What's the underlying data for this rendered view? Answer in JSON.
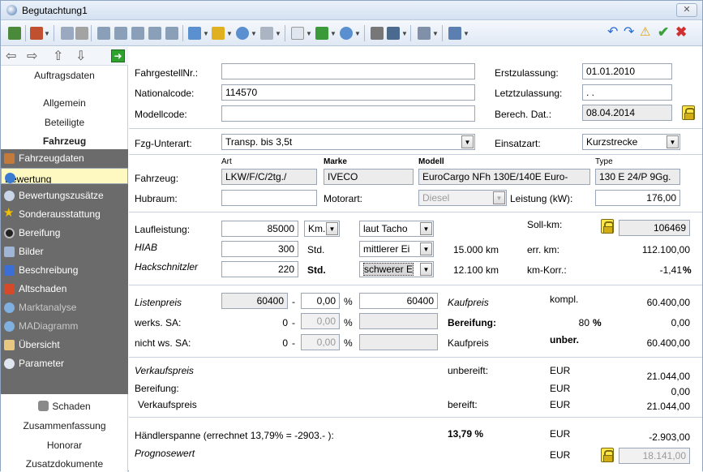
{
  "window": {
    "title": "Begutachtung1",
    "close": "✕"
  },
  "toolbar": {
    "icons": [
      "save-icon",
      "back-icon",
      "print-icon",
      "printer-icon",
      "calc1-icon",
      "calc2-icon",
      "calc3-icon",
      "calc4-icon",
      "calc5-icon",
      "new-doc-icon",
      "import-icon",
      "export-icon",
      "car-icon",
      "document-icon",
      "battery-icon",
      "send-icon",
      "camera-icon",
      "monitor-icon",
      "archive-icon",
      "print2-icon",
      "undo-icon",
      "redo-icon",
      "warning-icon",
      "check-icon",
      "cancel-icon"
    ]
  },
  "sidebar": {
    "nav": {
      "back": "⇦",
      "forward": "⇨",
      "up": "⇧",
      "down": "⇩",
      "go": "➜"
    },
    "top_items": [
      "Auftragsdaten",
      "Allgemein",
      "Beteiligte",
      "Fahrzeug"
    ],
    "menu": [
      {
        "label": "Fahrzeugdaten",
        "icon": "car-icon",
        "color": "#c47a3a"
      },
      {
        "label": "Bewertung",
        "icon": "rating-icon",
        "color": "#3a7ad0"
      },
      {
        "label": "Bewertungszusätze",
        "icon": "gear-icon",
        "color": "#c9d6ea"
      },
      {
        "label": "Sonderausstattung",
        "icon": "star-icon",
        "color": "#f2c200"
      },
      {
        "label": "Bereifung",
        "icon": "tire-icon",
        "color": "#222222"
      },
      {
        "label": "Bilder",
        "icon": "camera-icon",
        "color": "#9fb6d6"
      },
      {
        "label": "Beschreibung",
        "icon": "notes-icon",
        "color": "#3c6fd6"
      },
      {
        "label": "Altschaden",
        "icon": "damage-icon",
        "color": "#d64a2a"
      },
      {
        "label": "Marktanalyse",
        "icon": "market-icon",
        "color": "#7fb0e0"
      },
      {
        "label": "MADiagramm",
        "icon": "diagram-icon",
        "color": "#7fb0e0"
      },
      {
        "label": "Übersicht",
        "icon": "overview-icon",
        "color": "#e8c880"
      },
      {
        "label": "Parameter",
        "icon": "parameter-icon",
        "color": "#dfe6ef"
      }
    ],
    "bottom_items": [
      "Schaden",
      "Zusammenfassung",
      "Honorar",
      "Zusatzdokumente"
    ]
  },
  "form": {
    "fahrgestell_label": "FahrgestellNr.:",
    "fahrgestell_value": "",
    "national_label": "Nationalcode:",
    "national_value": "114570",
    "modell_label": "Modellcode:",
    "modell_value": "",
    "erstzul_label": "Erstzulassung:",
    "erstzul_value": "01.01.2010",
    "letztzul_label": "Letztzulassung:",
    "letztzul_value": " .  .",
    "berech_label": "Berech. Dat.:",
    "berech_value": "08.04.2014",
    "fzg_label": "Fzg-Unterart:",
    "fzg_value": "Transp. bis 3,5t",
    "einsatz_label": "Einsatzart:",
    "einsatz_value": "Kurzstrecke",
    "art_hdr": "Art",
    "marke_hdr": "Marke",
    "modell_hdr": "Modell",
    "type_hdr": "Type",
    "fahrzeug_label": "Fahrzeug:",
    "art_value": "LKW/F/C/2tg./",
    "marke_value": "IVECO",
    "modell_value2": "EuroCargo NFh 130E/140E Euro-",
    "type_value": "130 E 24/P 9Gg.",
    "hubraum_label": "Hubraum:",
    "hubraum_value": "",
    "motorart_label": "Motorart:",
    "motorart_value": "Diesel",
    "leistung_label": "Leistung (kW):",
    "leistung_value": "176,00",
    "lauf_label": "Laufleistung:",
    "lauf_value": "85000",
    "lauf_unit": "Km.",
    "lauf_src": "laut Tacho",
    "sollkm_label": "Soll-km:",
    "sollkm_value": "106469",
    "hiab_label": "HIAB",
    "hiab_value": "300",
    "hiab_unit": "Std.",
    "hiab_mode": "mittlerer Ei",
    "hiab_km": "15.000 km",
    "errkm_label": "err. km:",
    "errkm_value": "112.100,00",
    "hack_label": "Hackschnitzler",
    "hack_value": "220",
    "hack_unit": "Std.",
    "hack_mode": "schwerer E",
    "hack_km": "12.100 km",
    "kmkorr_label": "km-Korr.:",
    "kmkorr_value": "-1,41",
    "pct": "%",
    "listen_label": "Listenpreis",
    "listen_value": "60400",
    "listen_pct": "0,00",
    "listen_res": "60400",
    "kauf_label": "Kaufpreis",
    "kompl_label": "kompl.",
    "kompl_value": "60.400,00",
    "werks_label": "werks. SA:",
    "werks_value": "0",
    "werks_pct": "0,00",
    "bereif_label": "Bereifung:",
    "bereif_pct": "80",
    "bereif_value": "0,00",
    "nicht_label": "nicht ws. SA:",
    "nicht_value": "0",
    "nicht_pct": "0,00",
    "kauf2_label": "Kaufpreis",
    "unber_label": "unber.",
    "unber_value": "60.400,00",
    "vk_label": "Verkaufspreis",
    "unbereift_label": "unbereift:",
    "eur": "EUR",
    "vk_unbereift": "21.044,00",
    "bereif2_label": "Bereifung:",
    "bereif2_value": "0,00",
    "vk2_label": "Verkaufspreis",
    "bereift_label": "bereift:",
    "vk_bereift": "21.044,00",
    "haendler_label": "Händlerspanne (errechnet 13,79% = -2903.- ):",
    "haendler_pct": "13,79 %",
    "haendler_value": "-2.903,00",
    "prog_label": "Prognosewert",
    "prog_value": "18.141,00",
    "minus": "-"
  }
}
